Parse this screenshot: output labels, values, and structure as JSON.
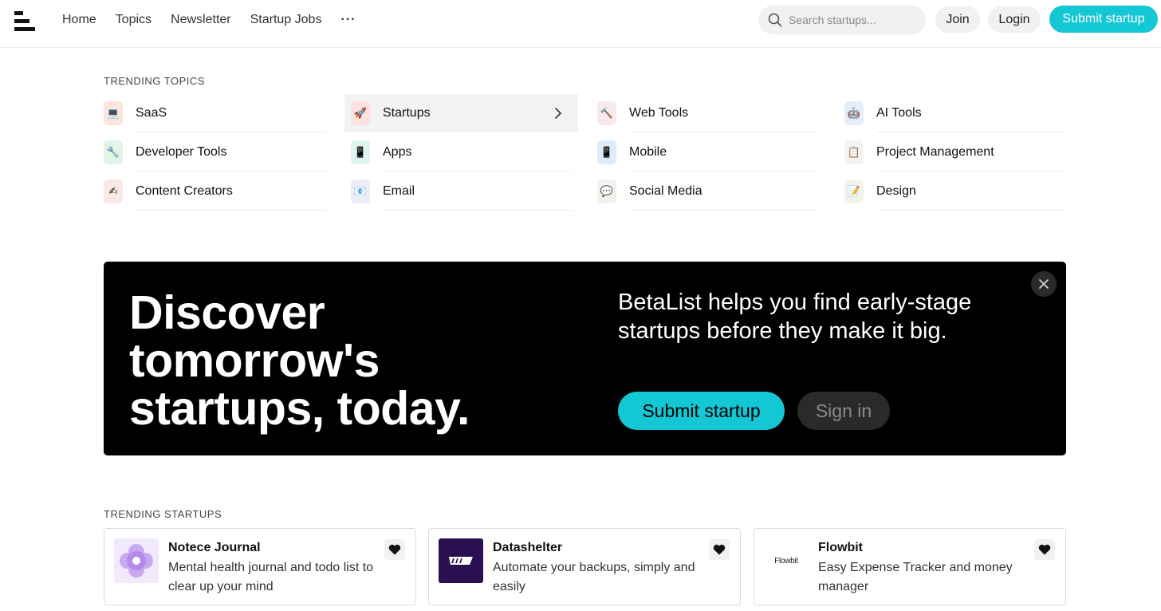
{
  "header": {
    "nav": [
      "Home",
      "Topics",
      "Newsletter",
      "Startup Jobs"
    ],
    "more_label": "···",
    "search_placeholder": "Search startups...",
    "join_label": "Join",
    "login_label": "Login",
    "submit_label": "Submit startup"
  },
  "trending_topics": {
    "title": "TRENDING TOPICS",
    "items": [
      {
        "label": "SaaS",
        "icon": "laptop-icon",
        "glyph": "💻",
        "bg": "#fde4dc"
      },
      {
        "label": "Startups",
        "icon": "rocket-icon",
        "glyph": "🚀",
        "bg": "#fde0e0",
        "active": true
      },
      {
        "label": "Web Tools",
        "icon": "hammer-icon",
        "glyph": "🔨",
        "bg": "#f8e9ef"
      },
      {
        "label": "AI Tools",
        "icon": "robot-icon",
        "glyph": "🤖",
        "bg": "#e3eef8"
      },
      {
        "label": "Developer Tools",
        "icon": "wrench-icon",
        "glyph": "🔧",
        "bg": "#e2f4e6"
      },
      {
        "label": "Apps",
        "icon": "phone-icon",
        "glyph": "📱",
        "bg": "#dff4ee"
      },
      {
        "label": "Mobile",
        "icon": "mobile-icon",
        "glyph": "📱",
        "bg": "#deebf8"
      },
      {
        "label": "Project Management",
        "icon": "clipboard-icon",
        "glyph": "📋",
        "bg": "#f3f3ef"
      },
      {
        "label": "Content Creators",
        "icon": "writing-hand-icon",
        "glyph": "✍",
        "bg": "#fbe9e6"
      },
      {
        "label": "Email",
        "icon": "envelope-icon",
        "glyph": "📧",
        "bg": "#ebeef8"
      },
      {
        "label": "Social Media",
        "icon": "speech-bubble-icon",
        "glyph": "💬",
        "bg": "#eef4ec"
      },
      {
        "label": "Design",
        "icon": "pencil-paper-icon",
        "glyph": "📝",
        "bg": "#f4f4ec"
      }
    ]
  },
  "hero": {
    "title": "Discover tomorrow's startups, today.",
    "description": "BetaList helps you find early-stage startups before they make it big.",
    "submit_label": "Submit startup",
    "signin_label": "Sign in"
  },
  "trending_startups": {
    "title": "TRENDING STARTUPS",
    "items": [
      {
        "name": "Notece Journal",
        "description": "Mental health journal and todo list to clear up your mind",
        "thumb_icon": "flower-logo-icon"
      },
      {
        "name": "Datashelter",
        "description": "Automate your backups, simply and easily",
        "thumb_icon": "datashelter-logo-icon"
      },
      {
        "name": "Flowbit",
        "description": "Easy Expense Tracker and money manager",
        "thumb_icon": "flowbit-logo-icon",
        "thumb_text": "Flowbit"
      }
    ]
  },
  "colors": {
    "accent": "#13c7d4",
    "hero_bg": "#000000"
  }
}
